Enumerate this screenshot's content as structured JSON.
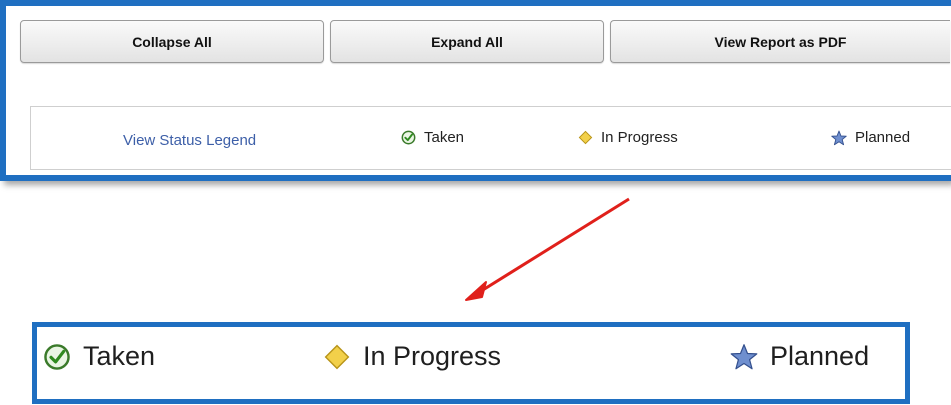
{
  "toolbar": {
    "collapse_label": "Collapse All",
    "expand_label": "Expand All",
    "pdf_label": "View Report as PDF"
  },
  "legend": {
    "link_label": "View Status Legend",
    "items": [
      {
        "label": "Taken",
        "icon": "check-circle-icon",
        "color": "#3a9a2a"
      },
      {
        "label": "In Progress",
        "icon": "diamond-icon",
        "color": "#e8c53a"
      },
      {
        "label": "Planned",
        "icon": "star-icon",
        "color": "#4f6fb0"
      }
    ]
  },
  "zoom_legend": {
    "items": [
      {
        "label": "Taken",
        "icon": "check-circle-icon"
      },
      {
        "label": "In Progress",
        "icon": "diamond-icon"
      },
      {
        "label": "Planned",
        "icon": "star-icon"
      }
    ]
  },
  "colors": {
    "frame_border": "#1f6fc1",
    "arrow": "#e0201b",
    "link": "#3d5fa8"
  }
}
